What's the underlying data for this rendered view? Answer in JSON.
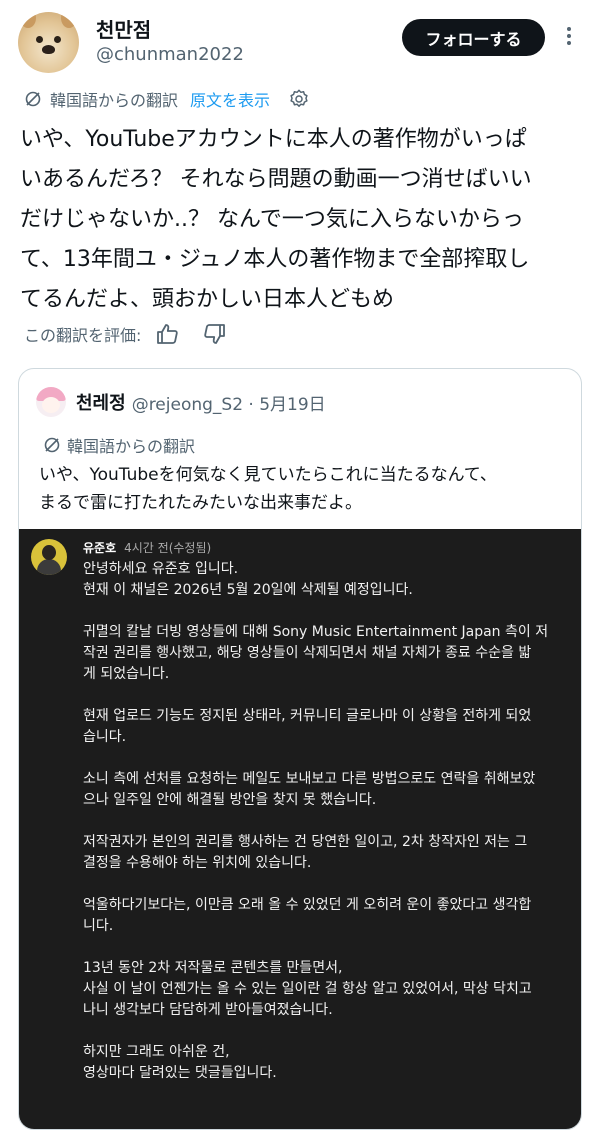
{
  "header": {
    "display_name": "천만점",
    "handle": "@chunman2022",
    "follow_label": "フォローする"
  },
  "translation": {
    "from_label": "韓国語からの翻訳",
    "show_original": "原文を表示"
  },
  "tweet": {
    "lines": [
      "いや、YouTubeアカウントに本人の著作物がいっぱ",
      "いあるんだろ？ それなら問題の動画一つ消せばいい",
      "だけじゃないか..？ なんで一つ気に入らないからっ",
      "て、13年間ユ・ジュノ本人の著作物まで全部搾取し",
      "てるんだよ、頭おかしい日本人どもめ"
    ]
  },
  "rating": {
    "label": "この翻訳を評価:"
  },
  "quote": {
    "display_name": "천레정",
    "meta": "@rejeong_S2 · 5月19日",
    "translation_label": "韓国語からの翻訳",
    "lines": [
      "いや、YouTubeを何気なく見ていたらこれに当たるなんて、",
      "まるで雷に打たれたみたいな出来事だよ。"
    ],
    "media": {
      "author": "유준호",
      "time": "4시간 전(수정됨)",
      "lines": [
        "안녕하세요 유준호 입니다.",
        "현재 이 채널은 2026년 5월 20일에 삭제될 예정입니다.",
        "",
        "귀멸의 칼날 더빙 영상들에 대해 Sony Music Entertainment Japan 측이 저",
        "작권 권리를 행사했고, 해당 영상들이 삭제되면서 채널 자체가 종료 수순을 밟",
        "게 되었습니다.",
        "",
        "현재 업로드 기능도 정지된 상태라, 커뮤니티 글로나마 이 상황을 전하게 되었",
        "습니다.",
        "",
        "소니 측에 선처를 요청하는 메일도 보내보고 다른 방법으로도 연락을 취해보았",
        "으나 일주일 안에 해결될 방안을 찾지 못 했습니다.",
        "",
        "저작권자가 본인의 권리를 행사하는 건 당연한 일이고, 2차 창작자인 저는 그",
        "결정을 수용해야 하는 위치에 있습니다.",
        "",
        "억울하다기보다는, 이만큼 오래 올 수 있었던 게 오히려 운이 좋았다고 생각합",
        "니다.",
        "",
        "13년 동안 2차 저작물로 콘텐츠를 만들면서,",
        "사실 이 날이 언젠가는 올 수 있는 일이란 걸 항상 알고 있었어서, 막상 닥치고",
        "나니 생각보다 담담하게 받아들여졌습니다.",
        "",
        "하지만 그래도 아쉬운 건,",
        "영상마다 달려있는 댓글들입니다."
      ]
    }
  }
}
